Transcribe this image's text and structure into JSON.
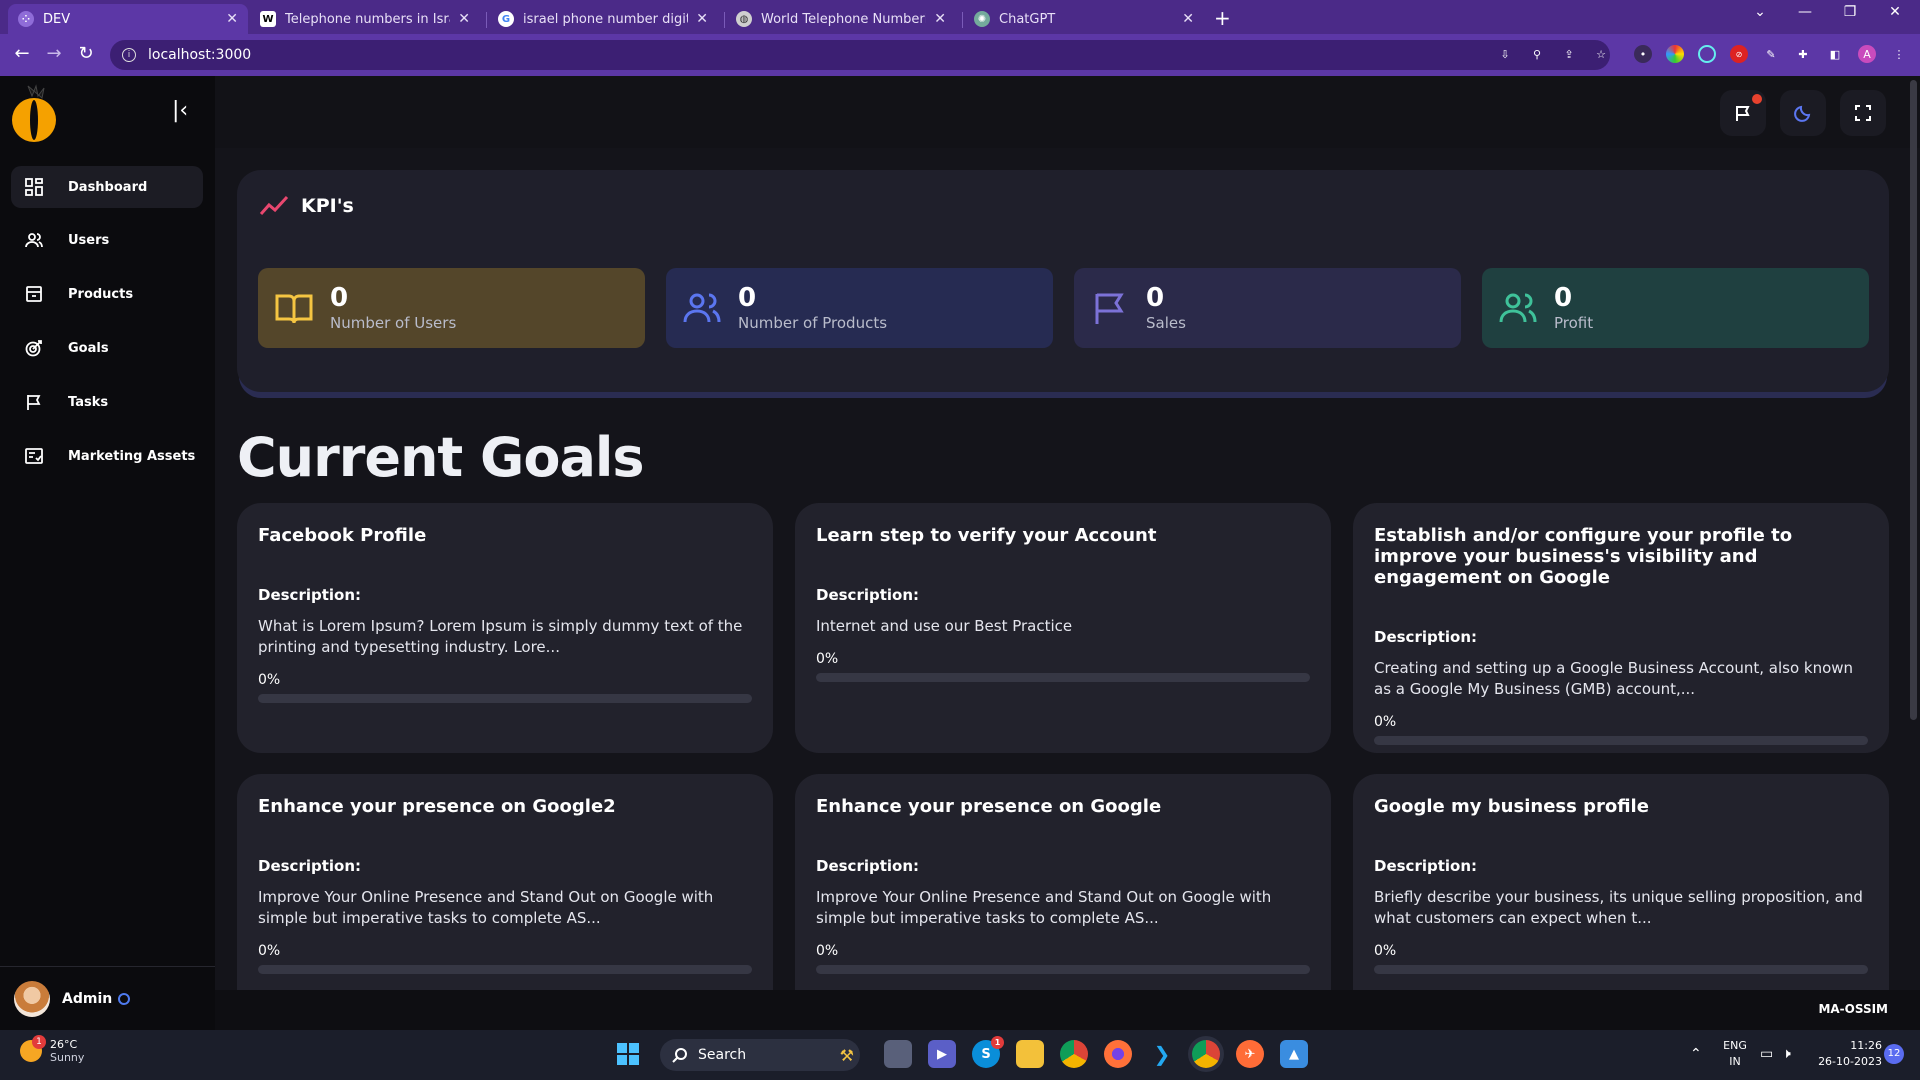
{
  "browser": {
    "tabs": [
      {
        "title": "DEV",
        "favicon": "dev-icon",
        "color": "#8f6cd8"
      },
      {
        "title": "Telephone numbers in Israel - W",
        "favicon": "wikipedia-icon",
        "color": "#ffffff"
      },
      {
        "title": "israel phone number digits - Go",
        "favicon": "google-icon",
        "color": "#ffffff"
      },
      {
        "title": "World Telephone Numbering Gu",
        "favicon": "globe-icon",
        "color": "#cfcfcf"
      },
      {
        "title": "ChatGPT",
        "favicon": "chatgpt-icon",
        "color": "#74aa9c"
      }
    ],
    "new_tab": "+",
    "url": "localhost:3000",
    "profile_initial": "A"
  },
  "app": {
    "sidebar": {
      "items": [
        {
          "label": "Dashboard",
          "icon": "dashboard-icon"
        },
        {
          "label": "Users",
          "icon": "users-icon"
        },
        {
          "label": "Products",
          "icon": "products-icon"
        },
        {
          "label": "Goals",
          "icon": "goals-icon"
        },
        {
          "label": "Tasks",
          "icon": "flag-icon"
        },
        {
          "label": "Marketing Assets",
          "icon": "assets-icon"
        }
      ],
      "user_name": "Admin"
    },
    "kpi": {
      "title": "KPI's",
      "cards": [
        {
          "value": "0",
          "label": "Number of Users",
          "icon": "book-icon",
          "bg": "#54462a",
          "icon_color": "#f5c542"
        },
        {
          "value": "0",
          "label": "Number of Products",
          "icon": "users-icon",
          "bg": "#262b52",
          "icon_color": "#5b76f0"
        },
        {
          "value": "0",
          "label": "Sales",
          "icon": "flag-icon",
          "bg": "#2b2a4a",
          "icon_color": "#7c72d8"
        },
        {
          "value": "0",
          "label": "Profit",
          "icon": "users-icon",
          "bg": "#1f4040",
          "icon_color": "#3fc29a"
        }
      ]
    },
    "goals": {
      "title": "Current Goals",
      "description_label": "Description:",
      "items": [
        {
          "title": "Facebook Profile",
          "description": "What is Lorem Ipsum? Lorem Ipsum is simply dummy text of the printing and typesetting industry. Lore...",
          "progress_text": "0%",
          "progress": 0
        },
        {
          "title": "Learn step to verify your Account",
          "description": "Internet and use our Best Practice",
          "progress_text": "0%",
          "progress": 0
        },
        {
          "title": "Establish and/or configure your profile to improve your business's visibility and engagement on Google",
          "description": "Creating and setting up a Google Business Account, also known as a Google My Business (GMB) account,...",
          "progress_text": "0%",
          "progress": 0
        },
        {
          "title": "Enhance your presence on Google2",
          "description": "Improve Your Online Presence and Stand Out on Google with simple but imperative tasks to complete AS...",
          "progress_text": "0%",
          "progress": 0
        },
        {
          "title": "Enhance your presence on Google",
          "description": "Improve Your Online Presence and Stand Out on Google with simple but imperative tasks to complete AS...",
          "progress_text": "0%",
          "progress": 0
        },
        {
          "title": "Google my business profile",
          "description": "Briefly describe your business, its unique selling proposition, and what customers can expect when t...",
          "progress_text": "0%",
          "progress": 0
        }
      ]
    },
    "footer_brand": "MA-OSSIM"
  },
  "taskbar": {
    "weather_badge": "1",
    "temperature": "26°C",
    "condition": "Sunny",
    "search_label": "Search",
    "skype_badge": "1",
    "language_line1": "ENG",
    "language_line2": "IN",
    "time": "11:26",
    "date": "26-10-2023",
    "notifications": "12"
  }
}
